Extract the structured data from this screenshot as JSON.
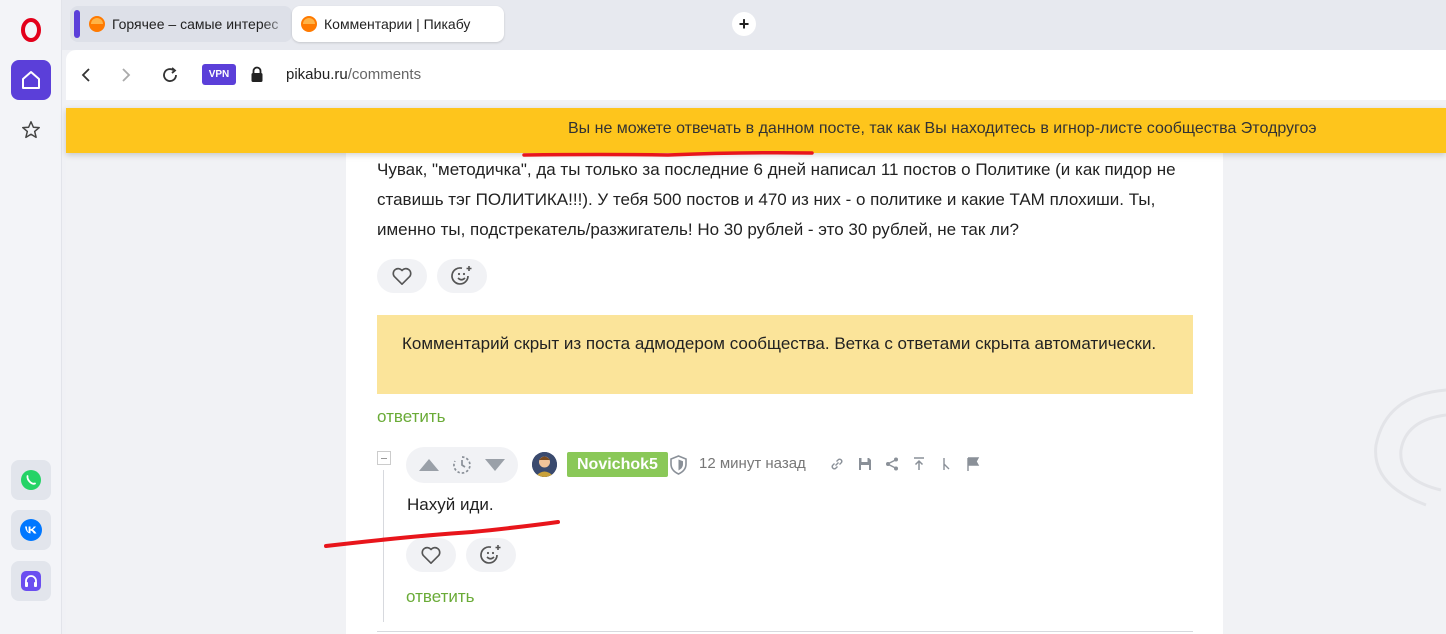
{
  "browser": {
    "tabs": [
      {
        "title": "Горячее – самые интерес"
      },
      {
        "title": "Комментарии | Пикабу"
      }
    ],
    "new_tab_symbol": "+",
    "vpn_label": "VPN",
    "url_host": "pikabu.ru",
    "url_path": "/comments"
  },
  "sidebar_icons": [
    "opera-logo-icon",
    "home-icon",
    "star-icon",
    "whatsapp-icon",
    "vk-icon",
    "music-player-icon"
  ],
  "banner": {
    "text": "Вы не можете отвечать в данном посте, так как Вы находитесь в игнор-листе сообщества Этодругоэ",
    "color": "#fec51c"
  },
  "comment": {
    "text": "Чувак, \"методичка\", да ты только за последние 6 дней написал 11 постов о Политике (и как пидор не ставишь тэг ПОЛИТИКА!!!). У тебя 500 постов и 470 из них - о политике и какие ТАМ плохиши. Ты, именно ты, подстрекатель/разжигатель! Но 30 рублей - это 30 рублей, не так ли?"
  },
  "hidden_notice": {
    "text": "Комментарий скрыт из поста адмодером сообщества. Ветка с ответами скрыта автоматически."
  },
  "reply_label": "ответить",
  "reply_comment": {
    "username": "Novichok5",
    "time": "12 минут назад",
    "text": "Нахуй иди.",
    "reply_label": "ответить"
  },
  "colors": {
    "accent_purple": "#5b3fd9",
    "link_green": "#6aab37",
    "username_bg": "#8ac858",
    "notice_bg": "#fbe49a",
    "annotation_red": "#e8151b"
  }
}
